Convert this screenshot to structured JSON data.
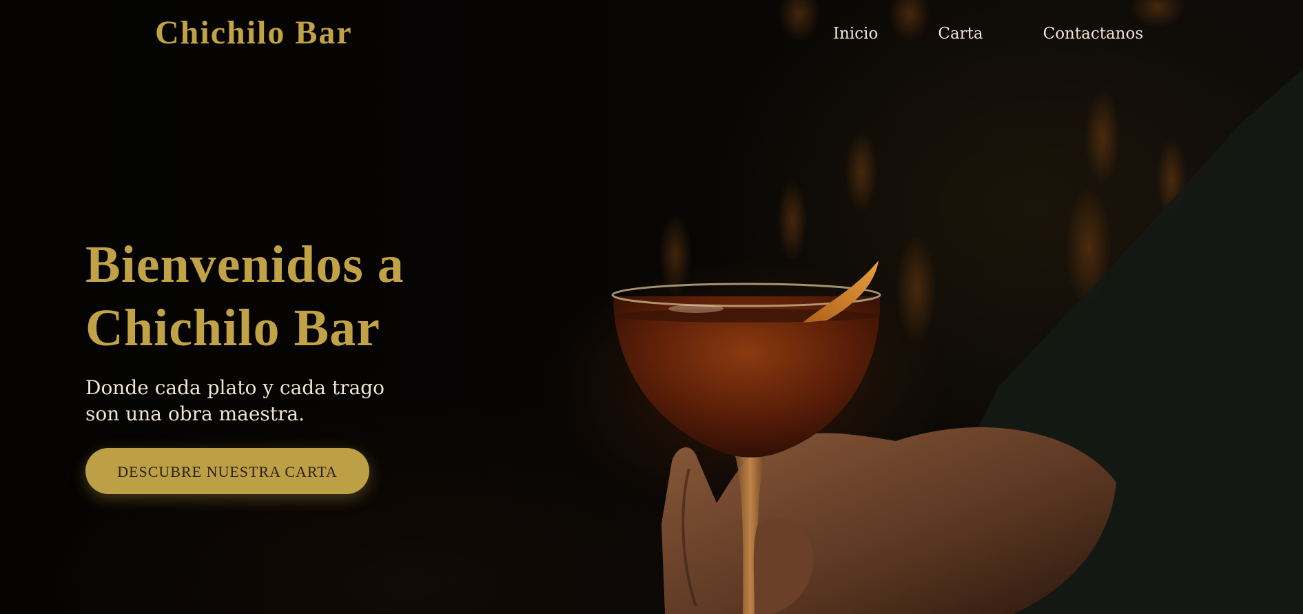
{
  "header": {
    "brand": "Chichilo Bar",
    "nav": [
      {
        "label": "Inicio"
      },
      {
        "label": "Carta"
      },
      {
        "label": "Contactanos"
      }
    ]
  },
  "hero": {
    "title_line_1": "Bienvenidos a",
    "title_line_2": "Chichilo Bar",
    "subtitle_line_1": "Donde cada plato y cada trago",
    "subtitle_line_2": "son una obra maestra.",
    "cta_label": "DESCUBRE NUESTRA CARTA"
  },
  "colors": {
    "accent_gold": "#c2a246",
    "text_cream": "#efe6d2",
    "background": "#050403",
    "cta_text": "#2a2216"
  }
}
